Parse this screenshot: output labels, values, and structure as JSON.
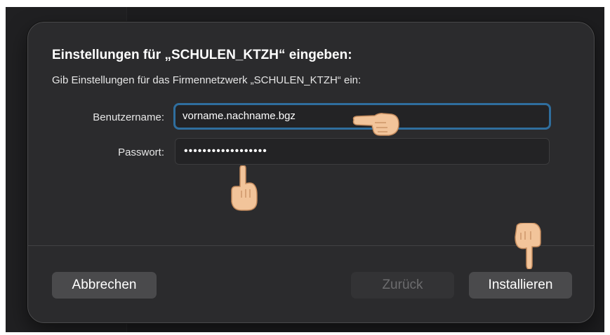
{
  "dialog": {
    "title": "Einstellungen für „SCHULEN_KTZH“ eingeben:",
    "subtitle": "Gib Einstellungen für das Firmennetzwerk „SCHULEN_KTZH“ ein:"
  },
  "form": {
    "username_label": "Benutzername:",
    "username_value": "vorname.nachname.bgz",
    "password_label": "Passwort:",
    "password_value": "••••••••••••••••••"
  },
  "buttons": {
    "cancel_label": "Abbrechen",
    "back_label": "Zurück",
    "install_label": "Installieren"
  },
  "annotations": {
    "pointer_icon_right": "pointing-hand-right-icon",
    "pointer_icon_down": "pointing-hand-down-icon"
  },
  "colors": {
    "focus_ring": "#2f6e9e",
    "dialog_bg": "#2b2b2d",
    "button_bg": "#4a4a4c"
  }
}
